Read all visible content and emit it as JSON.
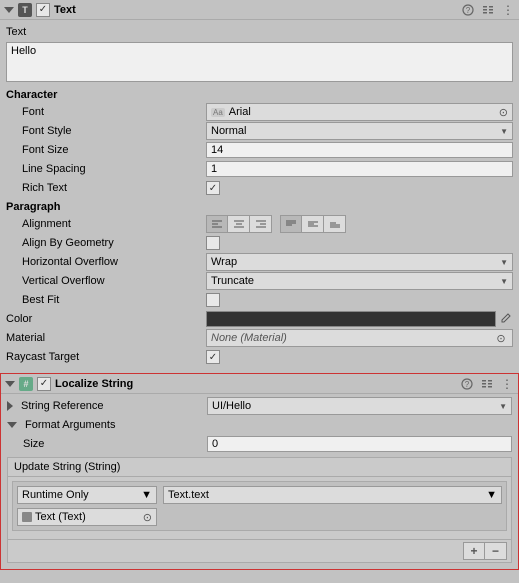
{
  "textComponent": {
    "title": "Text",
    "enabled": true,
    "text_label": "Text",
    "text_value": "Hello",
    "character_section": "Character",
    "font_label": "Font",
    "font_value": "Arial",
    "fontstyle_label": "Font Style",
    "fontstyle_value": "Normal",
    "fontsize_label": "Font Size",
    "fontsize_value": "14",
    "linespacing_label": "Line Spacing",
    "linespacing_value": "1",
    "richtext_label": "Rich Text",
    "richtext_value": true,
    "paragraph_section": "Paragraph",
    "alignment_label": "Alignment",
    "alignbygeom_label": "Align By Geometry",
    "alignbygeom_value": false,
    "hoverflow_label": "Horizontal Overflow",
    "hoverflow_value": "Wrap",
    "voverflow_label": "Vertical Overflow",
    "voverflow_value": "Truncate",
    "bestfit_label": "Best Fit",
    "bestfit_value": false,
    "color_label": "Color",
    "color_value": "#323232",
    "material_label": "Material",
    "material_value": "None (Material)",
    "raycast_label": "Raycast Target",
    "raycast_value": true
  },
  "localizeComponent": {
    "title": "Localize String",
    "enabled": true,
    "stringref_label": "String Reference",
    "stringref_value": "UI/Hello",
    "formatargs_label": "Format Arguments",
    "size_label": "Size",
    "size_value": "0",
    "event_title": "Update String (String)",
    "runtime_value": "Runtime Only",
    "function_value": "Text.text",
    "target_value": "Text (Text)"
  }
}
